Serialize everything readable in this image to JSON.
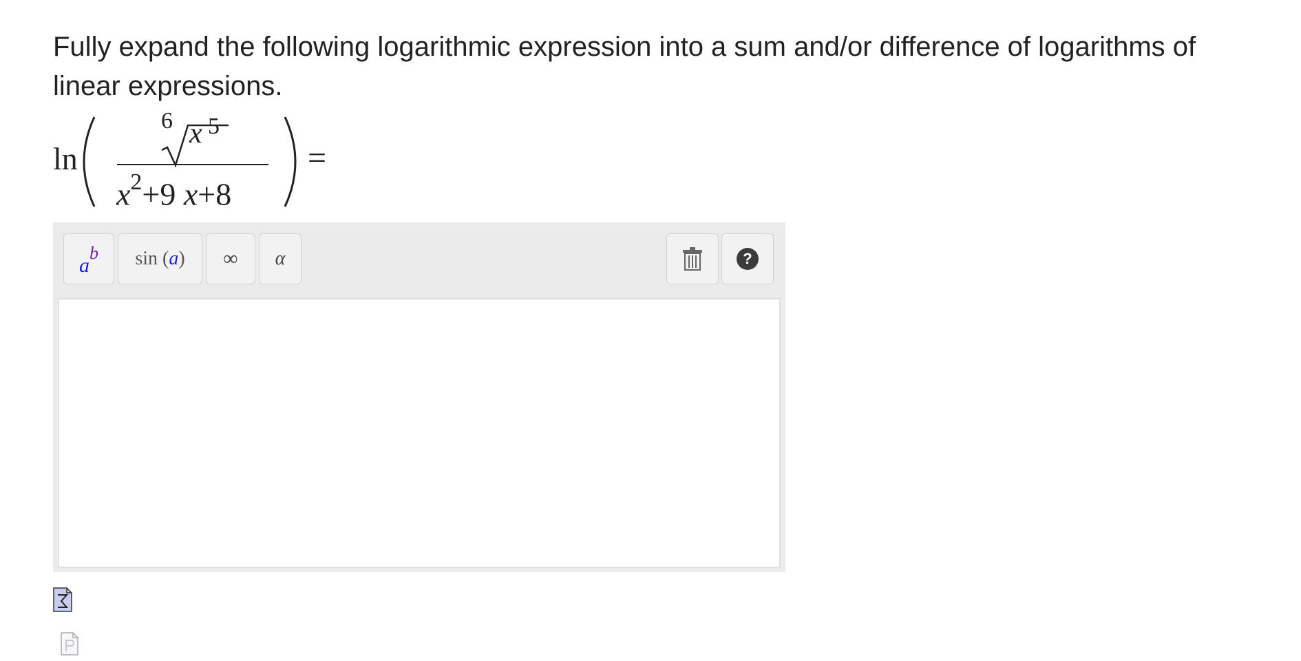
{
  "question": {
    "text": "Fully expand the following logarithmic expression into a sum and/or difference of logarithms of linear expressions."
  },
  "expression": {
    "func": "ln",
    "root_index": "6",
    "radicand_var": "x",
    "radicand_exp": "5",
    "denominator": {
      "var1": "x",
      "exp1": "2",
      "plus1": "+9 ",
      "var2": "x",
      "plus2": "+8"
    },
    "equals": "="
  },
  "toolbar": {
    "power": {
      "base": "a",
      "exponent": "b"
    },
    "sin": {
      "prefix": "sin (",
      "arg": "a",
      "suffix": ")"
    },
    "infinity": "∞",
    "alpha": "α",
    "help": "?"
  },
  "icons": {
    "trash": "trash-icon",
    "help": "help-icon",
    "equation_editor": "sigma-file-icon",
    "plain_text": "plain-text-file-icon"
  },
  "colors": {
    "power_base": "#1a1aff",
    "power_exponent": "#7a1fa2",
    "editor_background": "#ebebeb"
  },
  "answer": {
    "value": ""
  }
}
